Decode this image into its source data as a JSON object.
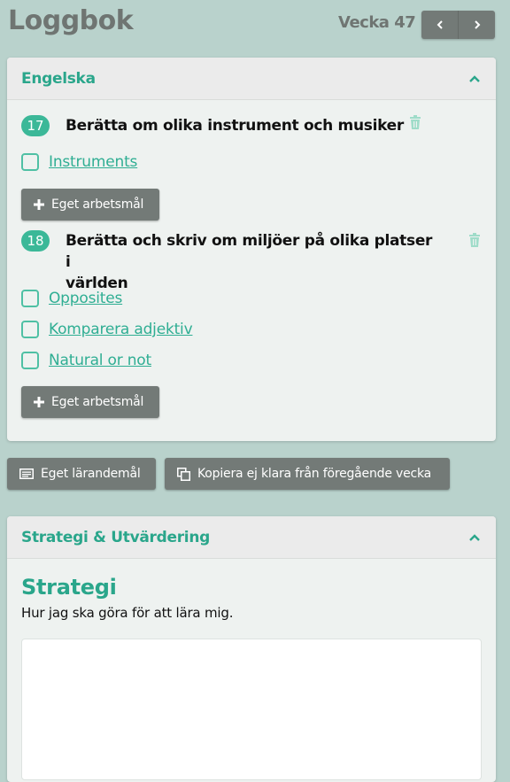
{
  "header": {
    "title": "Loggbok",
    "week": "Vecka 47",
    "prev_icon": "chevron-left-icon",
    "next_icon": "chevron-right-icon"
  },
  "subject_card": {
    "title": "Engelska",
    "goals": [
      {
        "number": "17",
        "text": "Berätta om olika instrument och musiker",
        "tasks": [
          "Instruments"
        ],
        "add_button": "Eget arbetsmål"
      },
      {
        "number": "18",
        "text_line1": "Berätta och skriv om miljöer på olika platser i",
        "text_line2": "världen",
        "tasks": [
          "Opposites",
          "Komparera adjektiv",
          "Natural or not"
        ],
        "add_button": "Eget arbetsmål"
      }
    ]
  },
  "actions": {
    "own_goal": "Eget lärandemål",
    "copy_unfinished": "Kopiera ej klara från föregående vecka"
  },
  "strategy_card": {
    "title": "Strategi & Utvärdering",
    "heading": "Strategi",
    "subtitle": "Hur jag ska göra för att lära mig."
  },
  "colors": {
    "accent": "#2aa68b",
    "badge": "#3bb898",
    "background": "#b9d2cc",
    "button": "#737a77"
  }
}
